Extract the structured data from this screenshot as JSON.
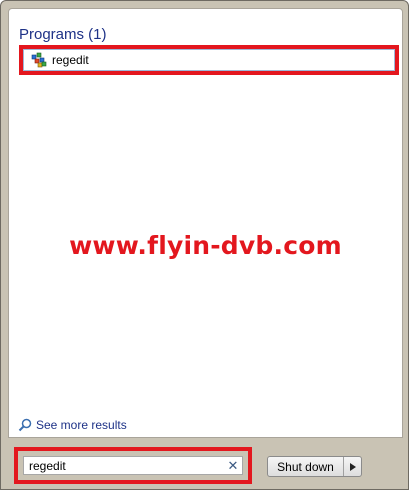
{
  "results": {
    "group_header": "Programs (1)",
    "items": [
      {
        "label": "regedit",
        "icon": "registry-editor-icon"
      }
    ]
  },
  "watermark": "www.flyin-dvb.com",
  "see_more": {
    "label": "See more results",
    "icon": "search-icon"
  },
  "search": {
    "value": "regedit",
    "clear_icon": "close-icon"
  },
  "shutdown": {
    "label": "Shut down",
    "arrow_icon": "triangle-right-icon"
  },
  "colors": {
    "highlight_red": "#e3171e",
    "header_blue": "#1e3287",
    "panel_background": "#c9c3b4"
  }
}
